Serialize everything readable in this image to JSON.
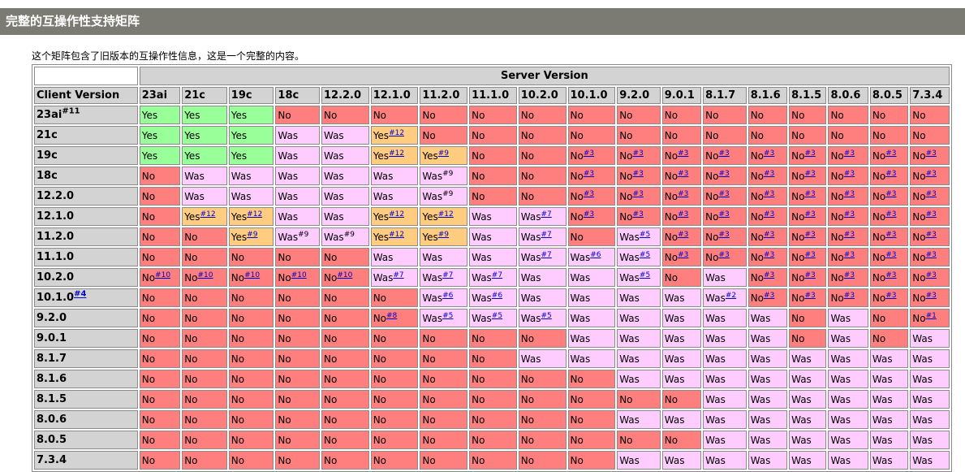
{
  "page": {
    "title": "完整的互操作性支持矩阵",
    "intro": "这个矩阵包含了旧版本的互操作性信息，这是一个完整的内容。"
  },
  "matrix": {
    "server_label": "Server Version",
    "client_label": "Client Version",
    "server_versions": [
      "23ai",
      "21c",
      "19c",
      "18c",
      "12.2.0",
      "12.1.0",
      "11.2.0",
      "11.1.0",
      "10.2.0",
      "10.1.0",
      "9.2.0",
      "9.0.1",
      "8.1.7",
      "8.1.6",
      "8.1.5",
      "8.0.6",
      "8.0.5",
      "7.3.4"
    ],
    "colors": {
      "yes": "#99ff99",
      "no": "#ff7f7f",
      "was": "#ffccff",
      "yes_note": "#ffcc80",
      "header": "#d3d3d3",
      "title_bar": "#7b7b73"
    },
    "rows": [
      {
        "client": "23ai",
        "client_note": "#11",
        "client_note_link": false,
        "cells": [
          "Yes",
          "Yes",
          "Yes",
          "No",
          "No",
          "No",
          "No",
          "No",
          "No",
          "No",
          "No",
          "No",
          "No",
          "No",
          "No",
          "No",
          "No",
          "No"
        ]
      },
      {
        "client": "21c",
        "cells": [
          "Yes",
          "Yes",
          "Yes",
          "Was",
          "Was",
          "Yes#12",
          "No",
          "No",
          "No",
          "No",
          "No",
          "No",
          "No",
          "No",
          "No",
          "No",
          "No",
          "No"
        ]
      },
      {
        "client": "19c",
        "cells": [
          "Yes",
          "Yes",
          "Yes",
          "Was",
          "Was",
          "Yes#12",
          "Yes#9",
          "No",
          "No",
          "No#3",
          "No#3",
          "No#3",
          "No#3",
          "No#3",
          "No#3",
          "No#3",
          "No#3",
          "No#3"
        ]
      },
      {
        "client": "18c",
        "cells": [
          "No",
          "Was",
          "Was",
          "Was",
          "Was",
          "Was",
          "Was~9",
          "No",
          "No",
          "No#3",
          "No#3",
          "No#3",
          "No#3",
          "No#3",
          "No#3",
          "No#3",
          "No#3",
          "No#3"
        ]
      },
      {
        "client": "12.2.0",
        "cells": [
          "No",
          "Was",
          "Was",
          "Was",
          "Was",
          "Was",
          "Was~9",
          "No",
          "No",
          "No#3",
          "No#3",
          "No#3",
          "No#3",
          "No#3",
          "No#3",
          "No#3",
          "No#3",
          "No#3"
        ]
      },
      {
        "client": "12.1.0",
        "cells": [
          "No",
          "Yes#12",
          "Yes#12",
          "Was",
          "Was",
          "Yes#12",
          "Yes#12",
          "Was",
          "Was#7",
          "No#3",
          "No#3",
          "No#3",
          "No#3",
          "No#3",
          "No#3",
          "No#3",
          "No#3",
          "No#3"
        ]
      },
      {
        "client": "11.2.0",
        "cells": [
          "No",
          "No",
          "Yes#9",
          "Was~9",
          "Was~9",
          "Yes#12",
          "Yes#9",
          "Was",
          "Was#7",
          "No",
          "Was#5",
          "No#3",
          "No#3",
          "No#3",
          "No#3",
          "No#3",
          "No#3",
          "No#3"
        ]
      },
      {
        "client": "11.1.0",
        "cells": [
          "No",
          "No",
          "No",
          "No",
          "No",
          "Was",
          "Was",
          "Was",
          "Was#7",
          "Was#6",
          "Was#5",
          "No#3",
          "No#3",
          "No#3",
          "No#3",
          "No#3",
          "No#3",
          "No#3"
        ]
      },
      {
        "client": "10.2.0",
        "cells": [
          "No#10",
          "No#10",
          "No#10",
          "No#10",
          "No#10",
          "Was#7",
          "Was#7",
          "Was#7",
          "Was",
          "Was",
          "Was#5",
          "No",
          "Was",
          "No#3",
          "No#3",
          "No#3",
          "No#3",
          "No#3"
        ]
      },
      {
        "client": "10.1.0",
        "client_note": "#4",
        "client_note_link": true,
        "cells": [
          "No",
          "No",
          "No",
          "No",
          "No",
          "No",
          "Was#6",
          "Was#6",
          "Was",
          "Was",
          "Was",
          "Was",
          "Was#2",
          "No#3",
          "No#3",
          "No#3",
          "No#3",
          "No#3"
        ]
      },
      {
        "client": "9.2.0",
        "cells": [
          "No",
          "No",
          "No",
          "No",
          "No",
          "No#8",
          "Was#5",
          "Was#5",
          "Was#5",
          "Was",
          "Was",
          "Was",
          "Was",
          "Was",
          "No",
          "Was",
          "No",
          "No#1"
        ]
      },
      {
        "client": "9.0.1",
        "cells": [
          "No",
          "No",
          "No",
          "No",
          "No",
          "No",
          "No",
          "No",
          "No",
          "Was",
          "Was",
          "Was",
          "Was",
          "Was",
          "No",
          "Was",
          "No",
          "Was"
        ]
      },
      {
        "client": "8.1.7",
        "cells": [
          "No",
          "No",
          "No",
          "No",
          "No",
          "No",
          "No",
          "No",
          "Was",
          "Was",
          "Was",
          "Was",
          "Was",
          "Was",
          "Was",
          "Was",
          "Was",
          "Was"
        ]
      },
      {
        "client": "8.1.6",
        "cells": [
          "No",
          "No",
          "No",
          "No",
          "No",
          "No",
          "No",
          "No",
          "No",
          "No",
          "Was",
          "Was",
          "Was",
          "Was",
          "Was",
          "Was",
          "Was",
          "Was"
        ]
      },
      {
        "client": "8.1.5",
        "cells": [
          "No",
          "No",
          "No",
          "No",
          "No",
          "No",
          "No",
          "No",
          "No",
          "No",
          "No",
          "No",
          "Was",
          "Was",
          "Was",
          "Was",
          "Was",
          "Was"
        ]
      },
      {
        "client": "8.0.6",
        "cells": [
          "No",
          "No",
          "No",
          "No",
          "No",
          "No",
          "No",
          "No",
          "No",
          "No",
          "Was",
          "Was",
          "Was",
          "Was",
          "Was",
          "Was",
          "Was",
          "Was"
        ]
      },
      {
        "client": "8.0.5",
        "cells": [
          "No",
          "No",
          "No",
          "No",
          "No",
          "No",
          "No",
          "No",
          "No",
          "No",
          "No",
          "No",
          "Was",
          "Was",
          "Was",
          "Was",
          "Was",
          "Was"
        ]
      },
      {
        "client": "7.3.4",
        "cells": [
          "No",
          "No",
          "No",
          "No",
          "No",
          "No",
          "No",
          "No",
          "No",
          "No",
          "Was",
          "Was",
          "Was",
          "Was",
          "Was",
          "Was",
          "Was",
          "Was"
        ]
      }
    ]
  }
}
